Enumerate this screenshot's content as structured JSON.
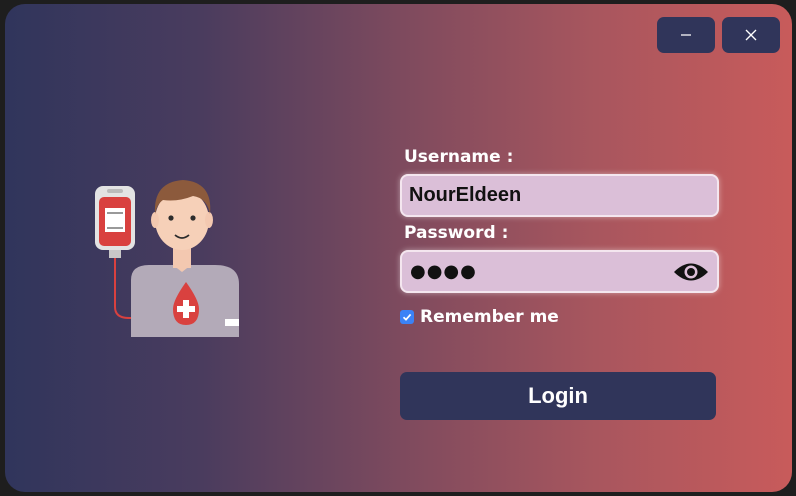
{
  "window": {
    "minimize_glyph": "–",
    "close_glyph": "✕"
  },
  "form": {
    "username_label": "Username :",
    "username_value": "NourEldeen",
    "password_label": "Password :",
    "password_masked": "●●●●",
    "remember_label": "Remember me",
    "remember_checked": true,
    "login_label": "Login"
  },
  "icons": {
    "illustration": "blood-donor-illustration",
    "show_password": "eye-icon",
    "checkbox": "checkmark-icon"
  },
  "colors": {
    "gradient_left": "#30355c",
    "gradient_right": "#c85b5b",
    "button_bg": "#30355a",
    "field_bg": "#dbbfd8",
    "checkbox": "#3b82f6"
  }
}
